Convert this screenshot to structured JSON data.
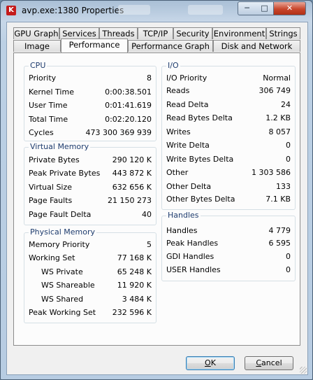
{
  "window": {
    "title": "avp.exe:1380 Properties",
    "icon_glyph": "K"
  },
  "caption_buttons": {
    "minimize": "─",
    "maximize": "□",
    "close": "✕"
  },
  "tabs_back": [
    {
      "label": "GPU Graph"
    },
    {
      "label": "Services"
    },
    {
      "label": "Threads"
    },
    {
      "label": "TCP/IP"
    },
    {
      "label": "Security"
    },
    {
      "label": "Environment"
    },
    {
      "label": "Strings"
    }
  ],
  "tabs_front": [
    {
      "label": "Image"
    },
    {
      "label": "Performance",
      "active": true
    },
    {
      "label": "Performance Graph"
    },
    {
      "label": "Disk and Network"
    }
  ],
  "cpu": {
    "title": "CPU",
    "rows": [
      {
        "label": "Priority",
        "value": "8"
      },
      {
        "label": "Kernel Time",
        "value": "0:00:38.501"
      },
      {
        "label": "User Time",
        "value": "0:01:41.619"
      },
      {
        "label": "Total Time",
        "value": "0:02:20.120"
      },
      {
        "label": "Cycles",
        "value": "473 300 369 939"
      }
    ]
  },
  "virtual_memory": {
    "title": "Virtual Memory",
    "rows": [
      {
        "label": "Private Bytes",
        "value": "290 120 K"
      },
      {
        "label": "Peak Private Bytes",
        "value": "443 872 K"
      },
      {
        "label": "Virtual Size",
        "value": "632 656 K"
      },
      {
        "label": "Page Faults",
        "value": "21 150 273"
      },
      {
        "label": "Page Fault Delta",
        "value": "40"
      }
    ]
  },
  "physical_memory": {
    "title": "Physical Memory",
    "rows": [
      {
        "label": "Memory Priority",
        "value": "5"
      },
      {
        "label": "Working Set",
        "value": "77 168 K"
      },
      {
        "label": "WS Private",
        "value": "65 248 K",
        "indent": true
      },
      {
        "label": "WS Shareable",
        "value": "11 920 K",
        "indent": true
      },
      {
        "label": "WS Shared",
        "value": "3 484 K",
        "indent": true
      },
      {
        "label": "Peak Working Set",
        "value": "232 596 K"
      }
    ]
  },
  "io": {
    "title": "I/O",
    "rows": [
      {
        "label": "I/O Priority",
        "value": "Normal"
      },
      {
        "label": "Reads",
        "value": "306 749"
      },
      {
        "label": "Read Delta",
        "value": "24"
      },
      {
        "label": "Read Bytes Delta",
        "value": "1.2  KB"
      },
      {
        "label": "Writes",
        "value": "8 057"
      },
      {
        "label": "Write Delta",
        "value": "0"
      },
      {
        "label": "Write Bytes Delta",
        "value": "0"
      },
      {
        "label": "Other",
        "value": "1 303 586"
      },
      {
        "label": "Other Delta",
        "value": "133"
      },
      {
        "label": "Other Bytes Delta",
        "value": "7.1  KB"
      }
    ]
  },
  "handles": {
    "title": "Handles",
    "rows": [
      {
        "label": "Handles",
        "value": "4 779"
      },
      {
        "label": "Peak Handles",
        "value": "6 595"
      },
      {
        "label": "GDI Handles",
        "value": "0"
      },
      {
        "label": "USER Handles",
        "value": "0"
      }
    ]
  },
  "buttons": {
    "ok": {
      "mnemonic": "O",
      "rest": "K"
    },
    "cancel": {
      "mnemonic": "C",
      "rest": "ancel"
    }
  }
}
